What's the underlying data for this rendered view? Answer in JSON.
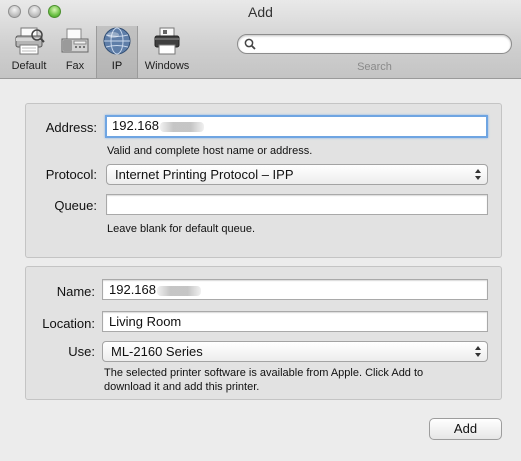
{
  "window": {
    "title": "Add"
  },
  "toolbar": {
    "items": [
      {
        "label": "Default",
        "icon": "printer-icon"
      },
      {
        "label": "Fax",
        "icon": "fax-icon"
      },
      {
        "label": "IP",
        "icon": "globe-icon",
        "selected": true
      },
      {
        "label": "Windows",
        "icon": "windows-printer-icon"
      }
    ],
    "search": {
      "label": "Search",
      "value": "",
      "placeholder": ""
    }
  },
  "connection": {
    "address": {
      "label": "Address:",
      "value": "192.168",
      "hint": "Valid and complete host name or address."
    },
    "protocol": {
      "label": "Protocol:",
      "value": "Internet Printing Protocol – IPP"
    },
    "queue": {
      "label": "Queue:",
      "value": "",
      "hint": "Leave blank for default queue."
    }
  },
  "printer": {
    "name": {
      "label": "Name:",
      "value": "192.168"
    },
    "location": {
      "label": "Location:",
      "value": "Living Room"
    },
    "use": {
      "label": "Use:",
      "value": "ML-2160 Series"
    },
    "hint_line1": "The selected printer software is available from Apple. Click Add to",
    "hint_line2": "download it and add this printer."
  },
  "footer": {
    "add_label": "Add"
  },
  "colors": {
    "focus_ring": "#6fa5e2",
    "window_bg": "#ececec",
    "zoom_button": "#6dc246"
  }
}
